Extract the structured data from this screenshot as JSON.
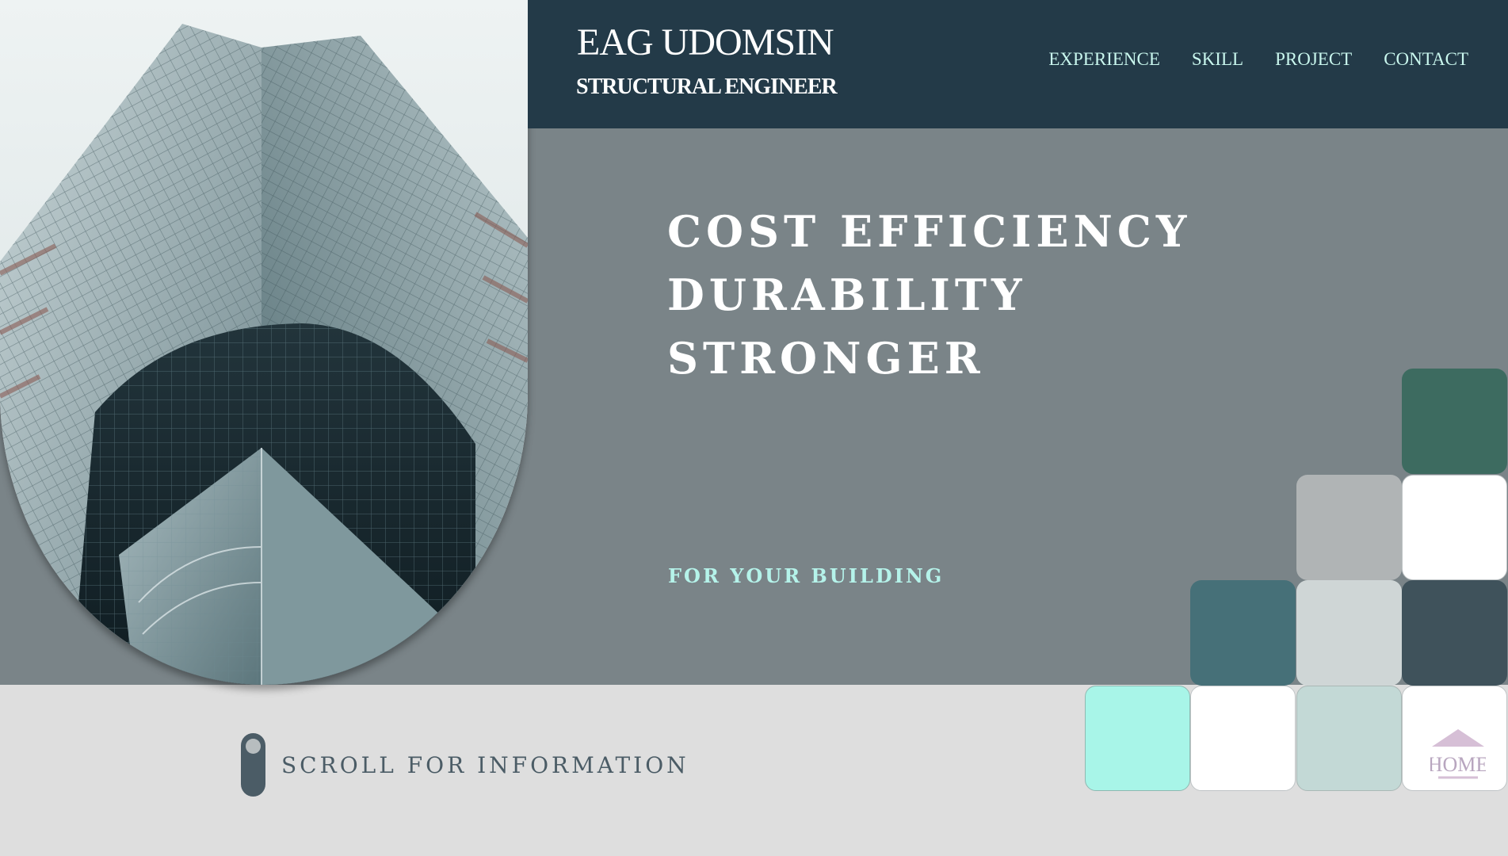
{
  "header": {
    "name": "EAG UDOMSIN",
    "role": "STRUCTURAL ENGINEER",
    "nav": [
      {
        "label": "EXPERIENCE"
      },
      {
        "label": "SKILL"
      },
      {
        "label": "PROJECT"
      },
      {
        "label": "CONTACT"
      }
    ]
  },
  "hero": {
    "headline": [
      "COST EFFICIENCY",
      "DURABILITY",
      "STRONGER"
    ],
    "tagline": "FOR YOUR BUILDING",
    "image": "glass-skyscraper-photo"
  },
  "scroll_hint": {
    "label": "SCROLL FOR INFORMATION",
    "icon": "scroll-mouse-icon"
  },
  "home_button": {
    "label": "HOME",
    "icon": "home-roof-icon"
  },
  "colors": {
    "header_bg": "#233a48",
    "hero_bg": "#7a8488",
    "page_bg": "#dedede",
    "nav_text": "#c9f7ee",
    "tagline": "#b5f3ea",
    "tiles": [
      "#3d6b60",
      "#b0b4b5",
      "#ffffff",
      "#467078",
      "#cfd6d6",
      "#3f525b",
      "#a8f5e8",
      "#ffffff",
      "#c3d9d6",
      "#ffffff"
    ]
  }
}
